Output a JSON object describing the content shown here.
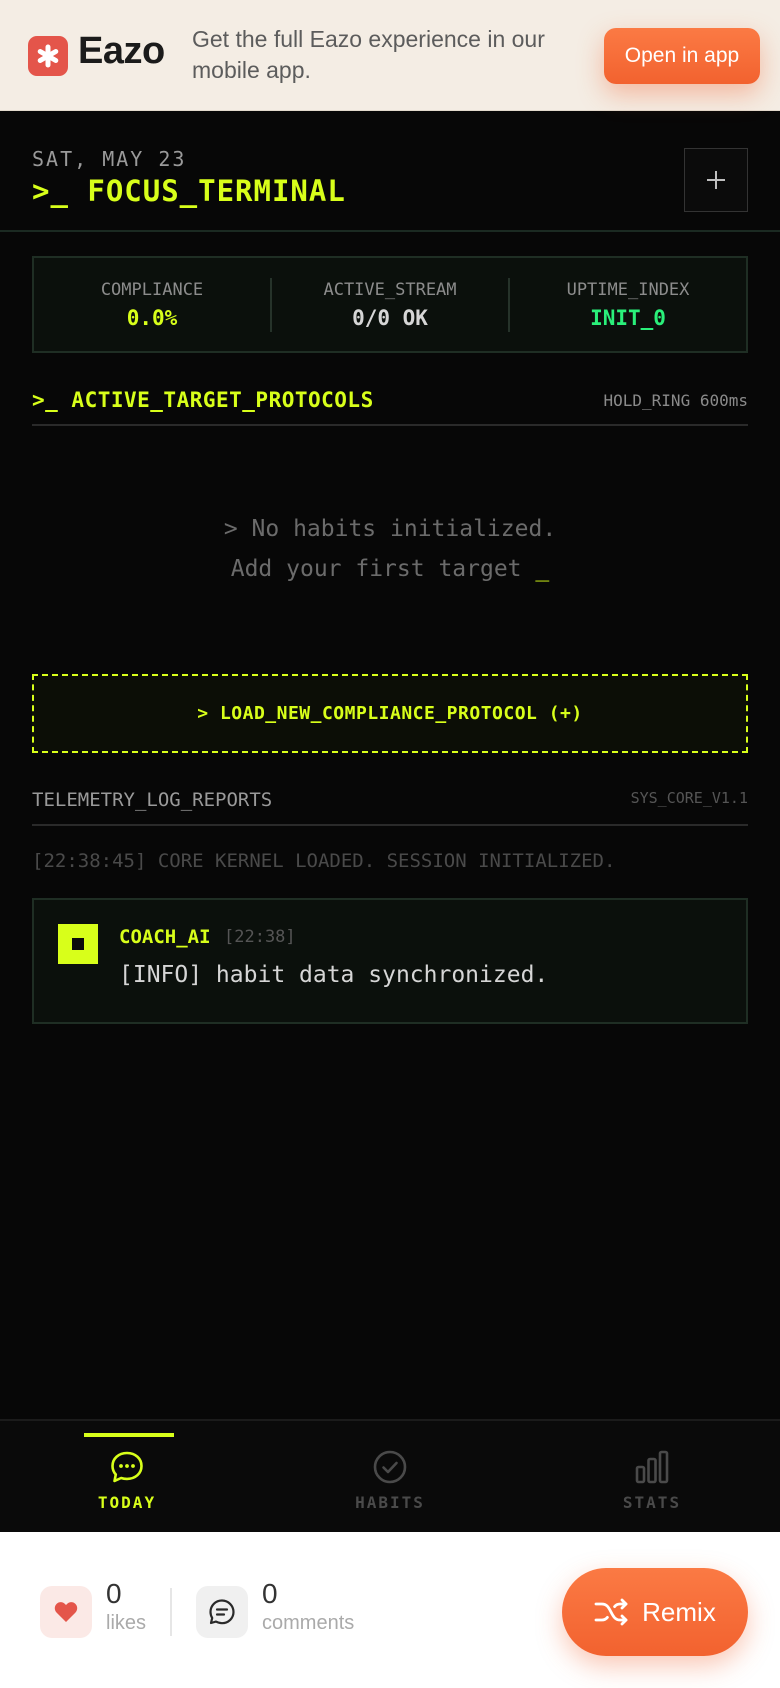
{
  "banner": {
    "brand": "Eazo",
    "message": "Get the full Eazo experience in our mobile app.",
    "open_button": "Open in app"
  },
  "header": {
    "date": "SAT, MAY 23",
    "title": ">_ FOCUS_TERMINAL",
    "add_icon": "plus-icon"
  },
  "stats": [
    {
      "label": "COMPLIANCE",
      "value": "0.0%",
      "color": "#d8ff1a"
    },
    {
      "label": "ACTIVE_STREAM",
      "value": "0/0 OK",
      "color": "#d6d6d6"
    },
    {
      "label": "UPTIME_INDEX",
      "value": "INIT_0",
      "color": "#2af07a"
    }
  ],
  "protocols": {
    "title": ">_ ACTIVE_TARGET_PROTOCOLS",
    "meta": "HOLD_RING 600ms",
    "empty_line1": "> No habits initialized.",
    "empty_line2": "Add your first target",
    "cursor": "_",
    "load_button": "> LOAD_NEW_COMPLIANCE_PROTOCOL (+)"
  },
  "telemetry": {
    "title": "TELEMETRY_LOG_REPORTS",
    "meta": "SYS_CORE_V1.1",
    "log_line": "[22:38:45] CORE KERNEL LOADED. SESSION INITIALIZED.",
    "coach": {
      "name": "COACH_AI",
      "time": "[22:38]",
      "message": "[INFO] habit data synchronized."
    }
  },
  "nav": {
    "items": [
      {
        "label": "TODAY",
        "icon": "chat-bubble-icon",
        "active": true
      },
      {
        "label": "HABITS",
        "icon": "check-circle-icon",
        "active": false
      },
      {
        "label": "STATS",
        "icon": "bar-chart-icon",
        "active": false
      }
    ],
    "active_color": "#d8ff1a",
    "inactive_color": "#4a4a4a"
  },
  "footer": {
    "likes_count": "0",
    "likes_label": "likes",
    "comments_count": "0",
    "comments_label": "comments",
    "remix_label": "Remix"
  },
  "colors": {
    "accent": "#d8ff1a",
    "brand_orange": "#f2622f",
    "background": "#070707"
  }
}
